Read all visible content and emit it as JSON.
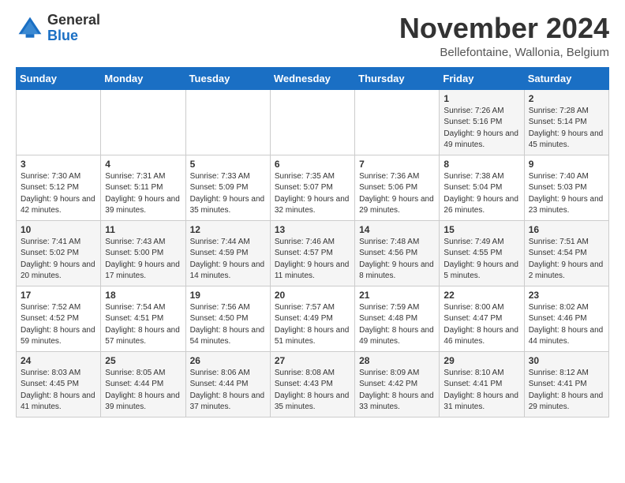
{
  "logo": {
    "general": "General",
    "blue": "Blue"
  },
  "header": {
    "month": "November 2024",
    "location": "Bellefontaine, Wallonia, Belgium"
  },
  "days_of_week": [
    "Sunday",
    "Monday",
    "Tuesday",
    "Wednesday",
    "Thursday",
    "Friday",
    "Saturday"
  ],
  "weeks": [
    [
      {
        "day": "",
        "info": ""
      },
      {
        "day": "",
        "info": ""
      },
      {
        "day": "",
        "info": ""
      },
      {
        "day": "",
        "info": ""
      },
      {
        "day": "",
        "info": ""
      },
      {
        "day": "1",
        "info": "Sunrise: 7:26 AM\nSunset: 5:16 PM\nDaylight: 9 hours and 49 minutes."
      },
      {
        "day": "2",
        "info": "Sunrise: 7:28 AM\nSunset: 5:14 PM\nDaylight: 9 hours and 45 minutes."
      }
    ],
    [
      {
        "day": "3",
        "info": "Sunrise: 7:30 AM\nSunset: 5:12 PM\nDaylight: 9 hours and 42 minutes."
      },
      {
        "day": "4",
        "info": "Sunrise: 7:31 AM\nSunset: 5:11 PM\nDaylight: 9 hours and 39 minutes."
      },
      {
        "day": "5",
        "info": "Sunrise: 7:33 AM\nSunset: 5:09 PM\nDaylight: 9 hours and 35 minutes."
      },
      {
        "day": "6",
        "info": "Sunrise: 7:35 AM\nSunset: 5:07 PM\nDaylight: 9 hours and 32 minutes."
      },
      {
        "day": "7",
        "info": "Sunrise: 7:36 AM\nSunset: 5:06 PM\nDaylight: 9 hours and 29 minutes."
      },
      {
        "day": "8",
        "info": "Sunrise: 7:38 AM\nSunset: 5:04 PM\nDaylight: 9 hours and 26 minutes."
      },
      {
        "day": "9",
        "info": "Sunrise: 7:40 AM\nSunset: 5:03 PM\nDaylight: 9 hours and 23 minutes."
      }
    ],
    [
      {
        "day": "10",
        "info": "Sunrise: 7:41 AM\nSunset: 5:02 PM\nDaylight: 9 hours and 20 minutes."
      },
      {
        "day": "11",
        "info": "Sunrise: 7:43 AM\nSunset: 5:00 PM\nDaylight: 9 hours and 17 minutes."
      },
      {
        "day": "12",
        "info": "Sunrise: 7:44 AM\nSunset: 4:59 PM\nDaylight: 9 hours and 14 minutes."
      },
      {
        "day": "13",
        "info": "Sunrise: 7:46 AM\nSunset: 4:57 PM\nDaylight: 9 hours and 11 minutes."
      },
      {
        "day": "14",
        "info": "Sunrise: 7:48 AM\nSunset: 4:56 PM\nDaylight: 9 hours and 8 minutes."
      },
      {
        "day": "15",
        "info": "Sunrise: 7:49 AM\nSunset: 4:55 PM\nDaylight: 9 hours and 5 minutes."
      },
      {
        "day": "16",
        "info": "Sunrise: 7:51 AM\nSunset: 4:54 PM\nDaylight: 9 hours and 2 minutes."
      }
    ],
    [
      {
        "day": "17",
        "info": "Sunrise: 7:52 AM\nSunset: 4:52 PM\nDaylight: 8 hours and 59 minutes."
      },
      {
        "day": "18",
        "info": "Sunrise: 7:54 AM\nSunset: 4:51 PM\nDaylight: 8 hours and 57 minutes."
      },
      {
        "day": "19",
        "info": "Sunrise: 7:56 AM\nSunset: 4:50 PM\nDaylight: 8 hours and 54 minutes."
      },
      {
        "day": "20",
        "info": "Sunrise: 7:57 AM\nSunset: 4:49 PM\nDaylight: 8 hours and 51 minutes."
      },
      {
        "day": "21",
        "info": "Sunrise: 7:59 AM\nSunset: 4:48 PM\nDaylight: 8 hours and 49 minutes."
      },
      {
        "day": "22",
        "info": "Sunrise: 8:00 AM\nSunset: 4:47 PM\nDaylight: 8 hours and 46 minutes."
      },
      {
        "day": "23",
        "info": "Sunrise: 8:02 AM\nSunset: 4:46 PM\nDaylight: 8 hours and 44 minutes."
      }
    ],
    [
      {
        "day": "24",
        "info": "Sunrise: 8:03 AM\nSunset: 4:45 PM\nDaylight: 8 hours and 41 minutes."
      },
      {
        "day": "25",
        "info": "Sunrise: 8:05 AM\nSunset: 4:44 PM\nDaylight: 8 hours and 39 minutes."
      },
      {
        "day": "26",
        "info": "Sunrise: 8:06 AM\nSunset: 4:44 PM\nDaylight: 8 hours and 37 minutes."
      },
      {
        "day": "27",
        "info": "Sunrise: 8:08 AM\nSunset: 4:43 PM\nDaylight: 8 hours and 35 minutes."
      },
      {
        "day": "28",
        "info": "Sunrise: 8:09 AM\nSunset: 4:42 PM\nDaylight: 8 hours and 33 minutes."
      },
      {
        "day": "29",
        "info": "Sunrise: 8:10 AM\nSunset: 4:41 PM\nDaylight: 8 hours and 31 minutes."
      },
      {
        "day": "30",
        "info": "Sunrise: 8:12 AM\nSunset: 4:41 PM\nDaylight: 8 hours and 29 minutes."
      }
    ]
  ]
}
